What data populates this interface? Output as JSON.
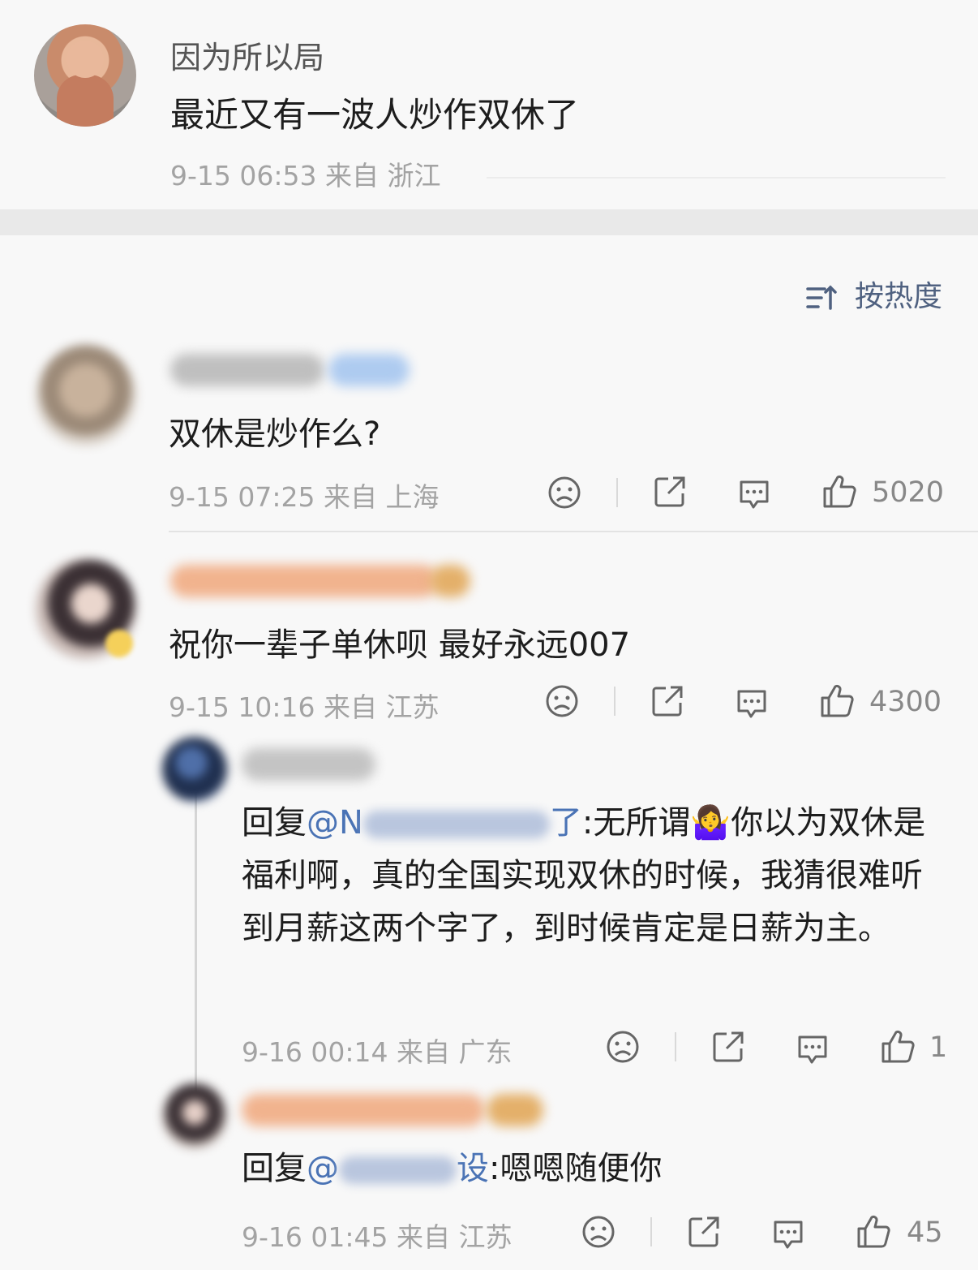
{
  "post": {
    "author": "因为所以局",
    "text": "最近又有一波人炒作双休了",
    "meta": "9-15 06:53  来自 浙江"
  },
  "sort": {
    "label": "按热度",
    "icon": "sort-icon"
  },
  "comments": [
    {
      "text": "双休是炒作么?",
      "meta": "9-15 07:25  来自 上海",
      "likes": "5020",
      "name_color": "#bfbfbf"
    },
    {
      "text": "祝你一辈子单休呗 最好永远007",
      "meta": "9-15 10:16  来自 江苏",
      "likes": "4300",
      "name_color": "#f1b38e"
    }
  ],
  "replies": [
    {
      "prefix": "回复",
      "mention_at": "@N",
      "mention_tail": "了",
      "body": ":无所谓🤷‍♀️你以为双休是福利啊，真的全国实现双休的时候，我猜很难听到月薪这两个字了，到时候肯定是日薪为主。",
      "meta": "9-16 00:14  来自 广东",
      "likes": "1"
    },
    {
      "prefix": "回复",
      "mention_at": "@",
      "mention_tail": "设",
      "body": ":嗯嗯随便你",
      "meta": "9-16 01:45  来自 江苏",
      "likes": "45"
    }
  ],
  "icons": {
    "dislike": "sad-face-icon",
    "share": "share-icon",
    "comment": "comment-icon",
    "like": "thumbs-up-icon"
  },
  "colors": {
    "accent": "#4f6180",
    "mention": "#4a73b5",
    "meta": "#a3a3a3"
  }
}
